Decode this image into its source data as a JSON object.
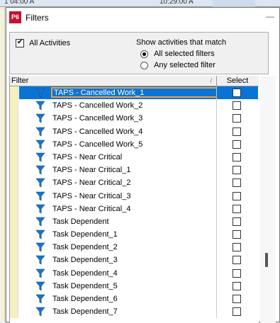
{
  "background": {
    "top_text": "1 04:00 A",
    "top_text2": "10:29:00 A"
  },
  "dialog": {
    "app_icon": "P6",
    "title": "Filters"
  },
  "options": {
    "all_activities_label": "All Activities",
    "all_activities_checked": true,
    "match_label": "Show activities that match",
    "radio_all": "All selected filters",
    "radio_any": "Any selected filter",
    "selected_radio": "all"
  },
  "grid": {
    "col_filter": "Filter",
    "col_select": "Select",
    "rows": [
      {
        "name": "TAPS - Cancelled Work_1",
        "selected": true
      },
      {
        "name": "TAPS - Cancelled Work_2"
      },
      {
        "name": "TAPS - Cancelled Work_3"
      },
      {
        "name": "TAPS - Cancelled Work_4"
      },
      {
        "name": "TAPS - Cancelled Work_5"
      },
      {
        "name": "TAPS - Near Critical"
      },
      {
        "name": "TAPS - Near Critical_1"
      },
      {
        "name": "TAPS - Near Critical_2"
      },
      {
        "name": "TAPS - Near Critical_3"
      },
      {
        "name": "TAPS - Near Critical_4"
      },
      {
        "name": "Task Dependent"
      },
      {
        "name": "Task Dependent_1"
      },
      {
        "name": "Task Dependent_2"
      },
      {
        "name": "Task Dependent_3"
      },
      {
        "name": "Task Dependent_4"
      },
      {
        "name": "Task Dependent_5"
      },
      {
        "name": "Task Dependent_6"
      },
      {
        "name": "Task Dependent_7"
      }
    ]
  },
  "colors": {
    "selection": "#0a74d6",
    "funnel": "#1a73c9",
    "app_icon": "#c8102e"
  }
}
